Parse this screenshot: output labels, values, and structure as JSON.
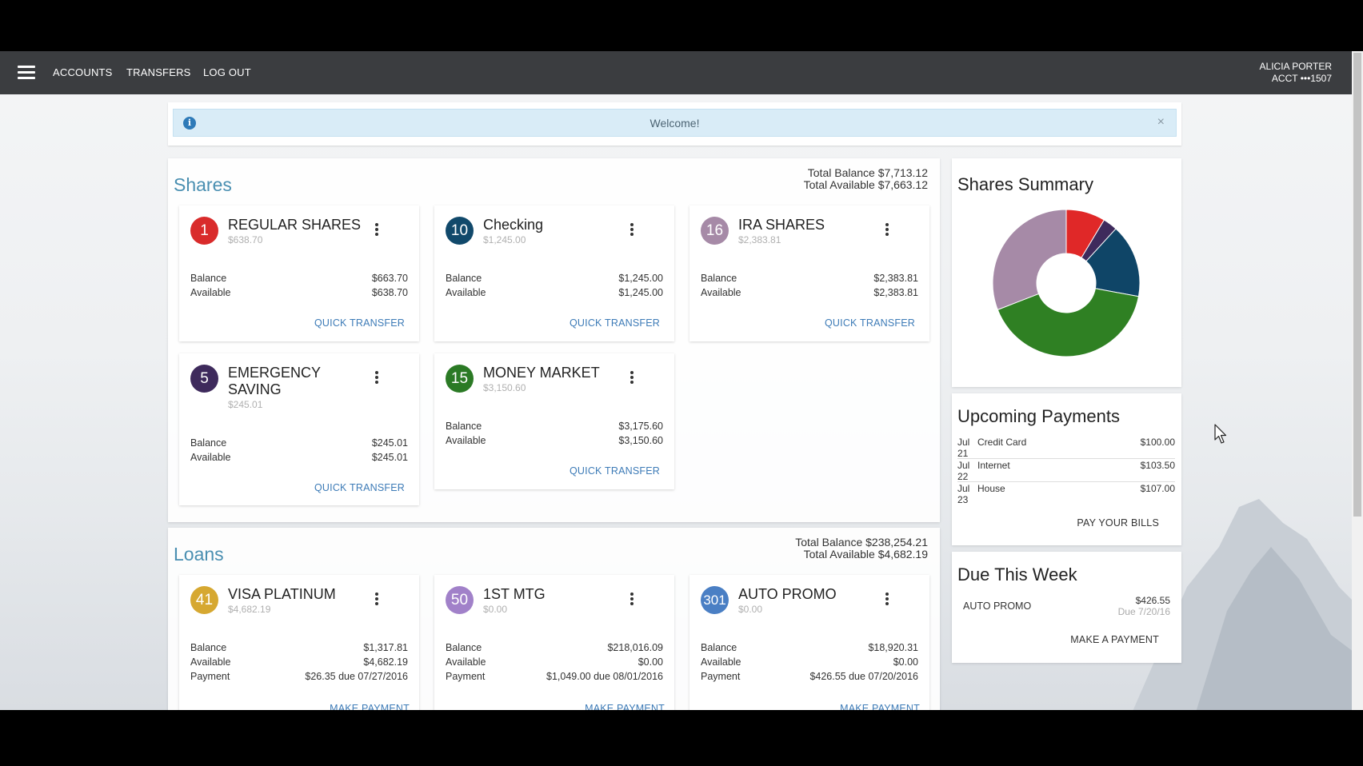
{
  "nav": {
    "accounts": "ACCOUNTS",
    "transfers": "TRANSFERS",
    "logout": "LOG OUT",
    "user_name": "ALICIA PORTER",
    "user_acct": "ACCT •••1507"
  },
  "welcome": {
    "message": "Welcome!",
    "close": "×",
    "info": "i"
  },
  "shares": {
    "title": "Shares",
    "total_balance": "Total Balance  $7,713.12",
    "total_available": "Total Available $7,663.12",
    "cards": [
      {
        "num": "1",
        "color": "#d92b2b",
        "name": "REGULAR SHARES",
        "sub": "$638.70",
        "balance_label": "Balance",
        "balance": "$663.70",
        "available_label": "Available",
        "available": "$638.70",
        "link": "QUICK TRANSFER"
      },
      {
        "num": "10",
        "color": "#11496b",
        "name": "Checking",
        "sub": "$1,245.00",
        "balance_label": "Balance",
        "balance": "$1,245.00",
        "available_label": "Available",
        "available": "$1,245.00",
        "link": "QUICK TRANSFER"
      },
      {
        "num": "16",
        "color": "#a68aa7",
        "name": "IRA SHARES",
        "sub": "$2,383.81",
        "balance_label": "Balance",
        "balance": "$2,383.81",
        "available_label": "Available",
        "available": "$2,383.81",
        "link": "QUICK TRANSFER"
      },
      {
        "num": "5",
        "color": "#3e2a5c",
        "name": "EMERGENCY SAVING",
        "sub": "$245.01",
        "balance_label": "Balance",
        "balance": "$245.01",
        "available_label": "Available",
        "available": "$245.01",
        "link": "QUICK TRANSFER"
      },
      {
        "num": "15",
        "color": "#2b7a25",
        "name": "MONEY MARKET",
        "sub": "$3,150.60",
        "balance_label": "Balance",
        "balance": "$3,175.60",
        "available_label": "Available",
        "available": "$3,150.60",
        "link": "QUICK TRANSFER"
      }
    ]
  },
  "loans": {
    "title": "Loans",
    "total_balance": "Total Balance $238,254.21",
    "total_available": "Total Available   $4,682.19",
    "cards": [
      {
        "num": "41",
        "color": "#d6a831",
        "name": "VISA PLATINUM",
        "sub": "$4,682.19",
        "balance_label": "Balance",
        "balance": "$1,317.81",
        "available_label": "Available",
        "available": "$4,682.19",
        "payment_label": "Payment",
        "payment": "$26.35 due 07/27/2016",
        "link": "MAKE PAYMENT"
      },
      {
        "num": "50",
        "color": "#a181c9",
        "name": "1ST MTG",
        "sub": "$0.00",
        "balance_label": "Balance",
        "balance": "$218,016.09",
        "available_label": "Available",
        "available": "$0.00",
        "payment_label": "Payment",
        "payment": "$1,049.00 due 08/01/2016",
        "link": "MAKE PAYMENT"
      },
      {
        "num": "301",
        "color": "#4a7fc4",
        "name": "AUTO PROMO",
        "sub": "$0.00",
        "balance_label": "Balance",
        "balance": "$18,920.31",
        "available_label": "Available",
        "available": "$0.00",
        "payment_label": "Payment",
        "payment": "$426.55 due 07/20/2016",
        "link": "MAKE PAYMENT"
      }
    ]
  },
  "summary": {
    "title": "Shares Summary",
    "slices": [
      {
        "label": "REGULAR SHARES",
        "value": 663.7,
        "color": "#e02828"
      },
      {
        "label": "EMERGENCY SAVING",
        "value": 245.01,
        "color": "#3e2a5c"
      },
      {
        "label": "Checking",
        "value": 1245.0,
        "color": "#0f4567"
      },
      {
        "label": "MONEY MARKET",
        "value": 3175.6,
        "color": "#2f8023"
      },
      {
        "label": "IRA SHARES",
        "value": 2383.81,
        "color": "#a68aa7"
      }
    ]
  },
  "upcoming": {
    "title": "Upcoming Payments",
    "items": [
      {
        "month": "Jul",
        "day": "21",
        "name": "Credit Card",
        "amount": "$100.00"
      },
      {
        "month": "Jul",
        "day": "22",
        "name": "Internet",
        "amount": "$103.50"
      },
      {
        "month": "Jul",
        "day": "23",
        "name": "House",
        "amount": "$107.00"
      }
    ],
    "link": "PAY YOUR BILLS"
  },
  "due": {
    "title": "Due This Week",
    "name": "AUTO PROMO",
    "amount": "$426.55",
    "date": "Due 7/20/16",
    "link": "MAKE A PAYMENT"
  }
}
